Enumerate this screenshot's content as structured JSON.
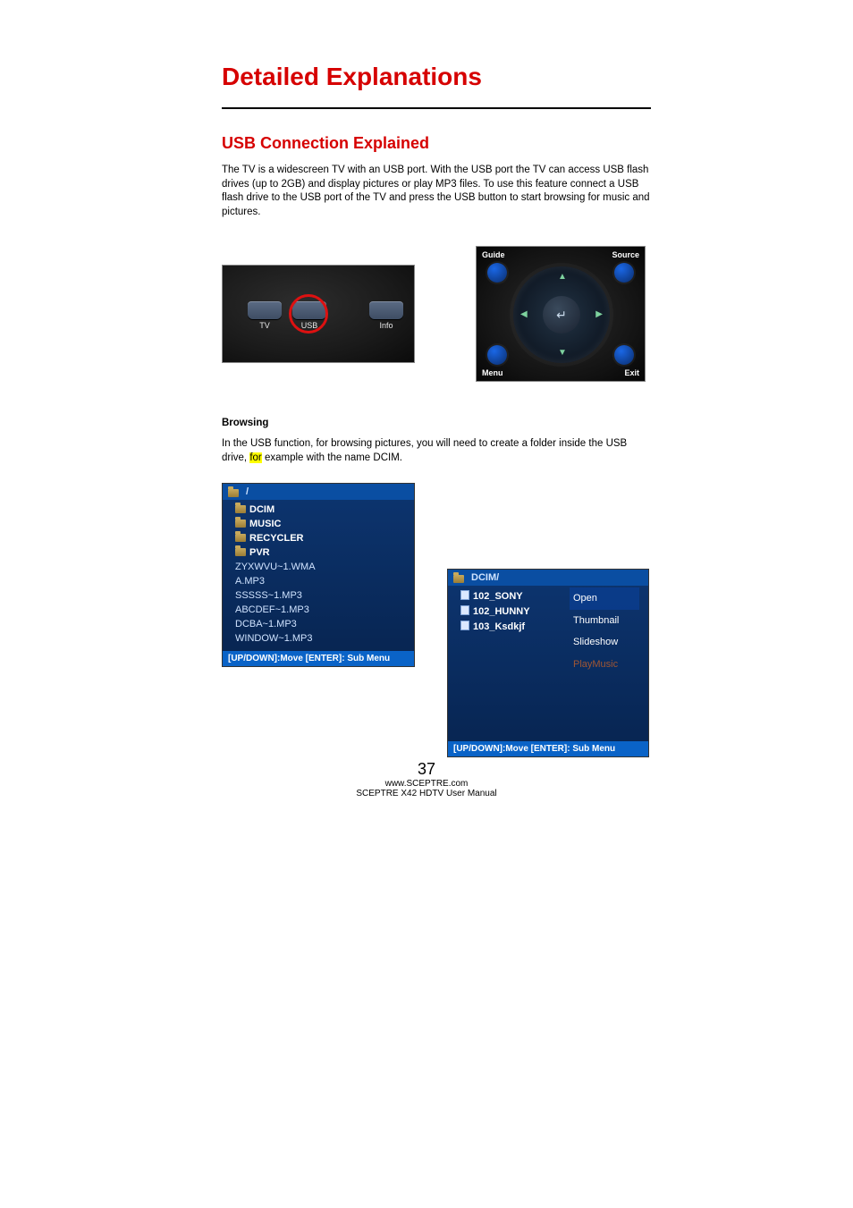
{
  "headings": {
    "h1": "Detailed Explanations",
    "h2": "USB Connection Explained",
    "browsing": "Browsing"
  },
  "paragraphs": {
    "intro": "The TV is a widescreen TV with an USB port.  With the USB port the TV can access USB flash drives (up to 2GB) and display pictures or play MP3 files.  To use this feature connect a USB flash drive to the USB port of the TV and press the USB button to start browsing for music and pictures.",
    "browsing_pre": "In the USB function, for browsing pictures, you will need to create a folder inside the USB drive, ",
    "browsing_hl": "for",
    "browsing_post": " example with the name DCIM."
  },
  "remote1": {
    "tv": "TV",
    "usb": "USB",
    "info": "Info"
  },
  "remote2": {
    "guide": "Guide",
    "source": "Source",
    "menu": "Menu",
    "exit": "Exit",
    "enter": "↵"
  },
  "shot1": {
    "header": "/",
    "folders": [
      "DCIM",
      "MUSIC",
      "RECYCLER",
      "PVR"
    ],
    "files": [
      "ZYXWVU~1.WMA",
      "A.MP3",
      "SSSSS~1.MP3",
      "ABCDEF~1.MP3",
      "DCBA~1.MP3",
      "WINDOW~1.MP3"
    ],
    "footer": "[UP/DOWN]:Move [ENTER]: Sub Menu"
  },
  "shot2": {
    "header": "DCIM/",
    "folders": [
      "102_SONY",
      "102_HUNNY",
      "103_Ksdkjf"
    ],
    "menu": [
      "Open",
      "Thumbnail",
      "Slideshow",
      "PlayMusic"
    ],
    "footer": "[UP/DOWN]:Move [ENTER]: Sub Menu"
  },
  "footer": {
    "page": "37",
    "url": "www.SCEPTRE.com",
    "manual": "SCEPTRE X42 HDTV User Manual"
  }
}
